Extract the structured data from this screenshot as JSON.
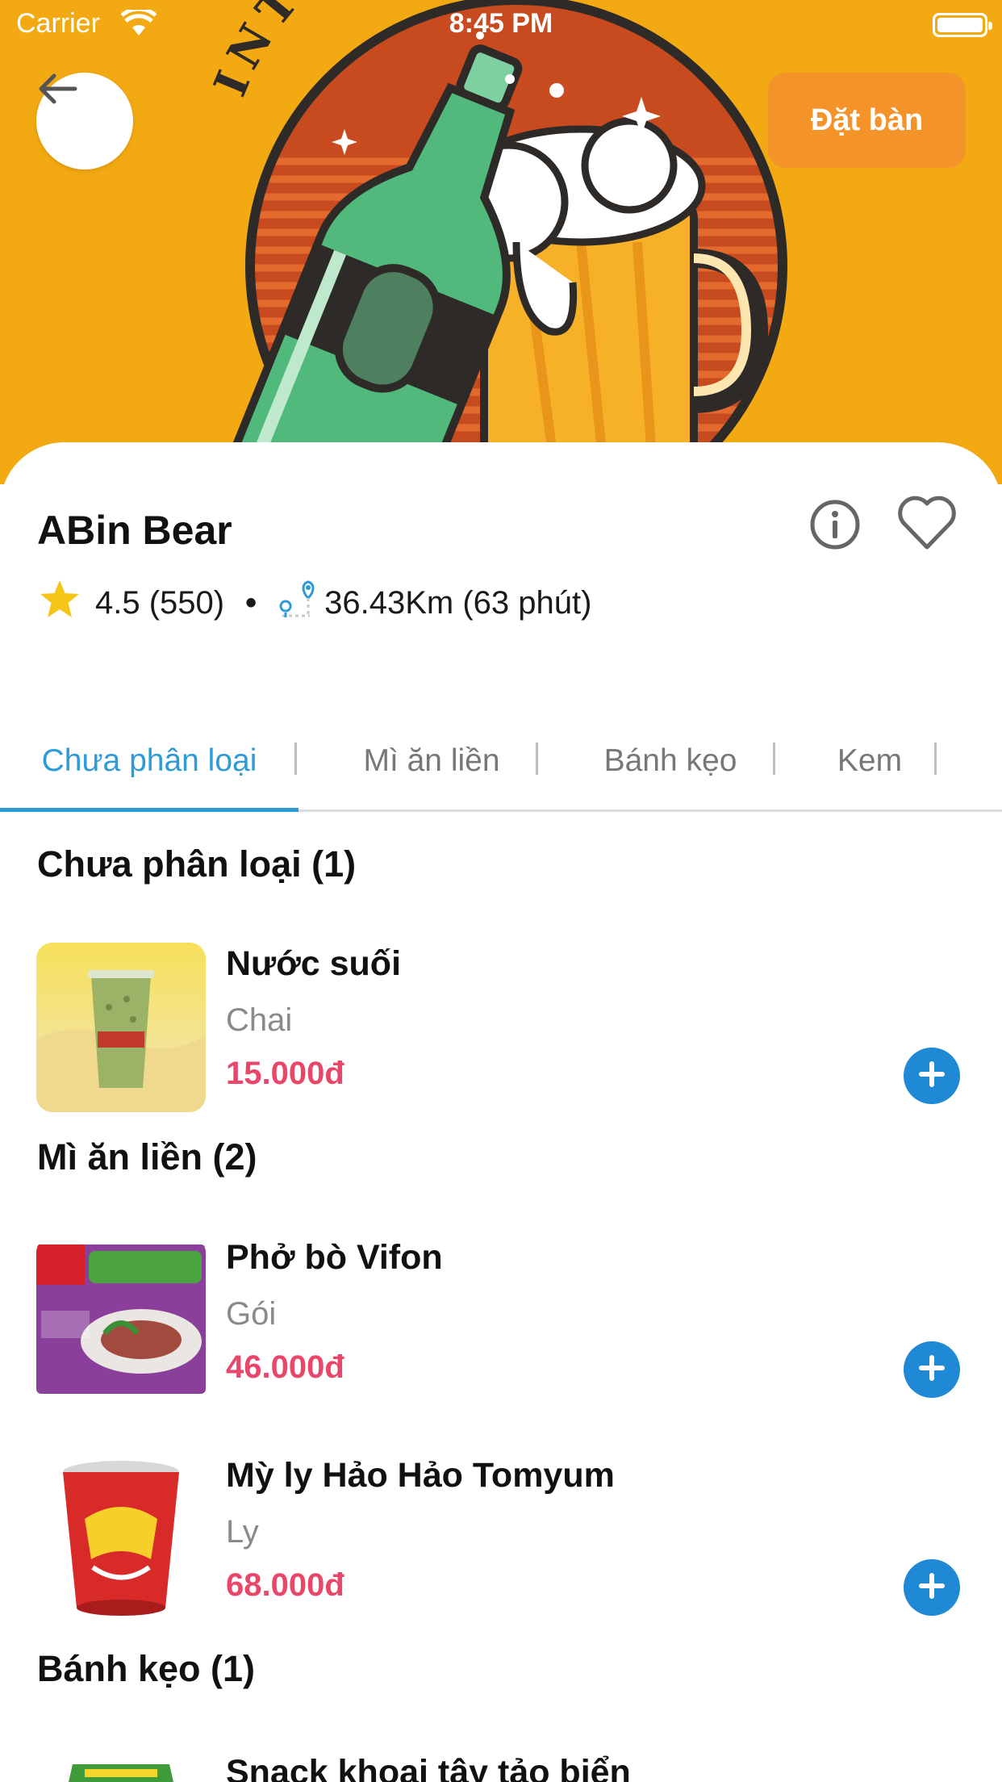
{
  "status_bar": {
    "carrier": "Carrier",
    "time": "8:45 PM"
  },
  "hero": {
    "logo_text": "INTERNATIONAL",
    "book_button_label": "Đặt bàn"
  },
  "shop": {
    "name": "ABin Bear",
    "rating": "4.5 (550)",
    "separator": "•",
    "distance": "36.43Km (63 phút)"
  },
  "tabs": [
    {
      "label": "Chưa phân loại",
      "active": true
    },
    {
      "label": "Mì ăn liền",
      "active": false
    },
    {
      "label": "Bánh kẹo",
      "active": false
    },
    {
      "label": "Kem",
      "active": false
    }
  ],
  "sections": [
    {
      "title": "Chưa phân loại (1)",
      "items": [
        {
          "name": "Nước suối",
          "unit": "Chai",
          "price": "15.000đ",
          "image_icon": "milk-tea-cup-icon"
        }
      ]
    },
    {
      "title": "Mì ăn liền (2)",
      "items": [
        {
          "name": "Phở bò Vifon",
          "unit": "Gói",
          "price": "46.000đ",
          "image_icon": "noodle-pack-icon"
        },
        {
          "name": "Mỳ ly Hảo Hảo Tomyum",
          "unit": "Ly",
          "price": "68.000đ",
          "image_icon": "noodle-cup-icon"
        }
      ]
    },
    {
      "title": "Bánh kẹo (1)",
      "items": [
        {
          "name": "Snack khoai tây tảo biển",
          "unit": "",
          "price": "",
          "image_icon": "snack-bag-icon"
        }
      ]
    }
  ],
  "colors": {
    "hero_background": "#f3aa12",
    "book_button": "#f4932a",
    "active_tab": "#2c9bd6",
    "price": "#e8476a",
    "add_button": "#2089d6"
  }
}
